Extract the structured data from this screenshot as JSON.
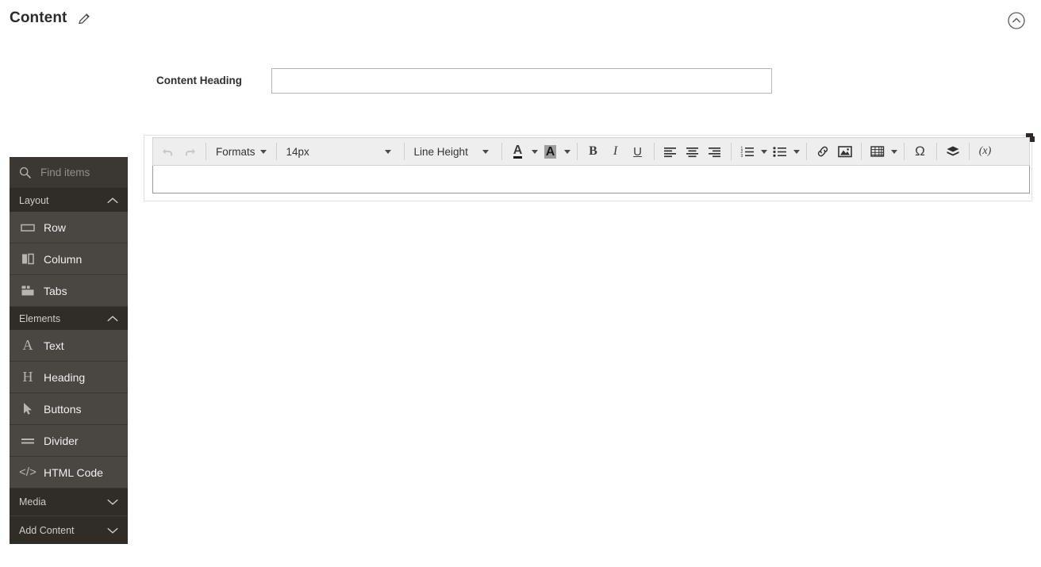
{
  "header": {
    "title": "Content",
    "edit_icon": "pencil-icon",
    "collapse_icon": "chevron-up-circle-icon"
  },
  "form": {
    "heading_label": "Content Heading",
    "heading_value": "",
    "heading_placeholder": ""
  },
  "editor": {
    "body_value": "",
    "toolbar": {
      "undo": {
        "label": "Undo",
        "icon": "undo-arrow-icon",
        "disabled": true
      },
      "redo": {
        "label": "Redo",
        "icon": "redo-arrow-icon",
        "disabled": true
      },
      "formats": "Formats",
      "font_size": "14px",
      "line_height": "Line Height",
      "text_color": "A",
      "background_color": "A",
      "bold": "B",
      "italic": "I",
      "underline": "U",
      "align_left": "align-left-icon",
      "align_center": "align-center-icon",
      "align_right": "align-right-icon",
      "numbered_list": "numbered-list-icon",
      "bullet_list": "bullet-list-icon",
      "link": "link-icon",
      "image": "image-icon",
      "table": "table-icon",
      "special_char": "Ω",
      "layers": "layers-icon",
      "variable": "(x)"
    }
  },
  "sidebar": {
    "search_placeholder": "Find items",
    "search_value": "",
    "search_icon": "search-icon",
    "sections": [
      {
        "label": "Layout",
        "expanded": true,
        "items": [
          {
            "label": "Row",
            "icon": "row-icon"
          },
          {
            "label": "Column",
            "icon": "column-icon"
          },
          {
            "label": "Tabs",
            "icon": "tabs-icon"
          }
        ]
      },
      {
        "label": "Elements",
        "expanded": true,
        "items": [
          {
            "label": "Text",
            "icon": "text-a-icon"
          },
          {
            "label": "Heading",
            "icon": "heading-h-icon"
          },
          {
            "label": "Buttons",
            "icon": "cursor-arrow-icon"
          },
          {
            "label": "Divider",
            "icon": "divider-icon"
          },
          {
            "label": "HTML Code",
            "icon": "code-icon"
          }
        ]
      },
      {
        "label": "Media",
        "expanded": false,
        "items": []
      },
      {
        "label": "Add Content",
        "expanded": false,
        "items": []
      }
    ]
  },
  "colors": {
    "sidebar_item_bg": "#4a4641",
    "sidebar_section_bg": "#302d29",
    "toolbar_bg": "#eeeeee",
    "page_bg": "#ffffff"
  }
}
